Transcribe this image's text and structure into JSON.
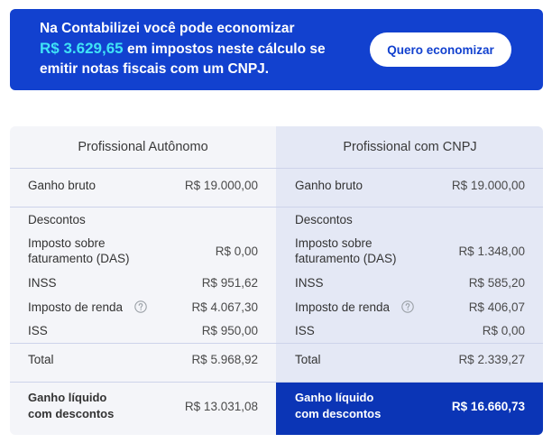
{
  "banner": {
    "message_line1": "Na Contabilizei você pode economizar",
    "savings_amount": "R$ 3.629,65",
    "message_line2": "em impostos neste cálculo se",
    "message_line3": "emitir notas fiscais com um CNPJ.",
    "cta_label": "Quero economizar",
    "colors": {
      "background": "#1241cf",
      "amount": "#3fe3f6",
      "text": "#ffffff"
    }
  },
  "comparison": {
    "help_icon": "question-circle-icon",
    "colors": {
      "left_column_bg": "#f4f5f9",
      "right_column_bg": "#e4e8f5",
      "highlight_bg": "#0b35b6",
      "divider": "#cdd3ea"
    },
    "columns": [
      {
        "title": "Profissional Autônomo",
        "gross_label": "Ganho bruto",
        "gross_value": "R$ 19.000,00",
        "discounts_label": "Descontos",
        "items": [
          {
            "label": "Imposto sobre faturamento (DAS)",
            "value": "R$ 0,00"
          },
          {
            "label": "INSS",
            "value": "R$ 951,62"
          },
          {
            "label": "Imposto de renda",
            "value": "R$ 4.067,30",
            "has_help": true
          },
          {
            "label": "ISS",
            "value": "R$ 950,00"
          }
        ],
        "total_label": "Total",
        "total_value": "R$ 5.968,92",
        "net_label": "Ganho líquido com descontos",
        "net_value": "R$ 13.031,08"
      },
      {
        "title": "Profissional com CNPJ",
        "gross_label": "Ganho bruto",
        "gross_value": "R$ 19.000,00",
        "discounts_label": "Descontos",
        "items": [
          {
            "label": "Imposto sobre faturamento (DAS)",
            "value": "R$ 1.348,00"
          },
          {
            "label": "INSS",
            "value": "R$ 585,20"
          },
          {
            "label": "Imposto de renda",
            "value": "R$ 406,07",
            "has_help": true
          },
          {
            "label": "ISS",
            "value": "R$ 0,00"
          }
        ],
        "total_label": "Total",
        "total_value": "R$ 2.339,27",
        "net_label": "Ganho líquido com descontos",
        "net_value": "R$ 16.660,73",
        "highlighted": true
      }
    ]
  }
}
